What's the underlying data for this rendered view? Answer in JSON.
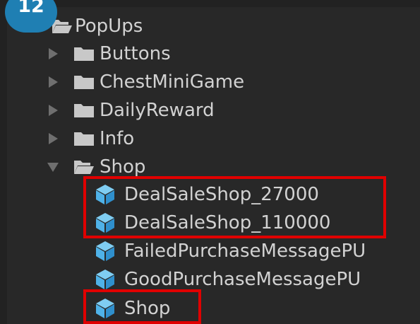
{
  "step_badge": "12",
  "tree": {
    "root": {
      "label": "PopUps",
      "icon": "open-folder-icon",
      "expanded": true
    },
    "folders": [
      {
        "label": "Buttons",
        "icon": "folder-icon",
        "expanded": false
      },
      {
        "label": "ChestMiniGame",
        "icon": "folder-icon",
        "expanded": false
      },
      {
        "label": "DailyReward",
        "icon": "folder-icon",
        "expanded": false
      },
      {
        "label": "Info",
        "icon": "folder-icon",
        "expanded": false
      },
      {
        "label": "Shop",
        "icon": "open-folder-icon",
        "expanded": true
      }
    ],
    "shop_items": [
      {
        "label": "DealSaleShop_27000",
        "icon": "prefab-cube-icon",
        "highlighted": true
      },
      {
        "label": "DealSaleShop_110000",
        "icon": "prefab-cube-icon",
        "highlighted": true
      },
      {
        "label": "FailedPurchaseMessagePU",
        "icon": "prefab-cube-icon",
        "highlighted": false
      },
      {
        "label": "GoodPurchaseMessagePU",
        "icon": "prefab-cube-icon",
        "highlighted": false
      },
      {
        "label": "Shop",
        "icon": "prefab-cube-icon",
        "highlighted": true
      }
    ]
  },
  "colors": {
    "background": "#282828",
    "text": "#d2d2d2",
    "badge": "#1f7fb3",
    "highlight": "#e00000",
    "prefab": "#4fb2e8",
    "folder": "#c8c8c8"
  }
}
